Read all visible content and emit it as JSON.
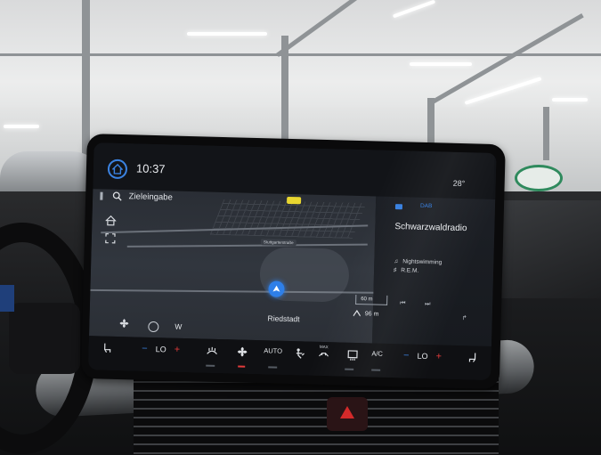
{
  "status": {
    "time": "10:37",
    "outside_temp": "28°"
  },
  "navigation": {
    "search_label": "Zieleingabe",
    "street_tag": "Stuttgarterstraße",
    "current_town": "Riedstadt",
    "heading": "W",
    "scale": "60 m",
    "distance": "96 m"
  },
  "media": {
    "source": "DAB",
    "station": "Schwarzwaldradio",
    "song": "Nightswimming",
    "artist": "R.E.M."
  },
  "climate": {
    "driver_temp": "LO",
    "passenger_temp": "LO",
    "auto_label": "AUTO",
    "ac_label": "A/C",
    "max_label": "MAX",
    "minus": "−",
    "plus": "+"
  },
  "colors": {
    "accent": "#3b82e0",
    "warm": "#e23b3b",
    "nav_marker": "#2e7fe8"
  }
}
